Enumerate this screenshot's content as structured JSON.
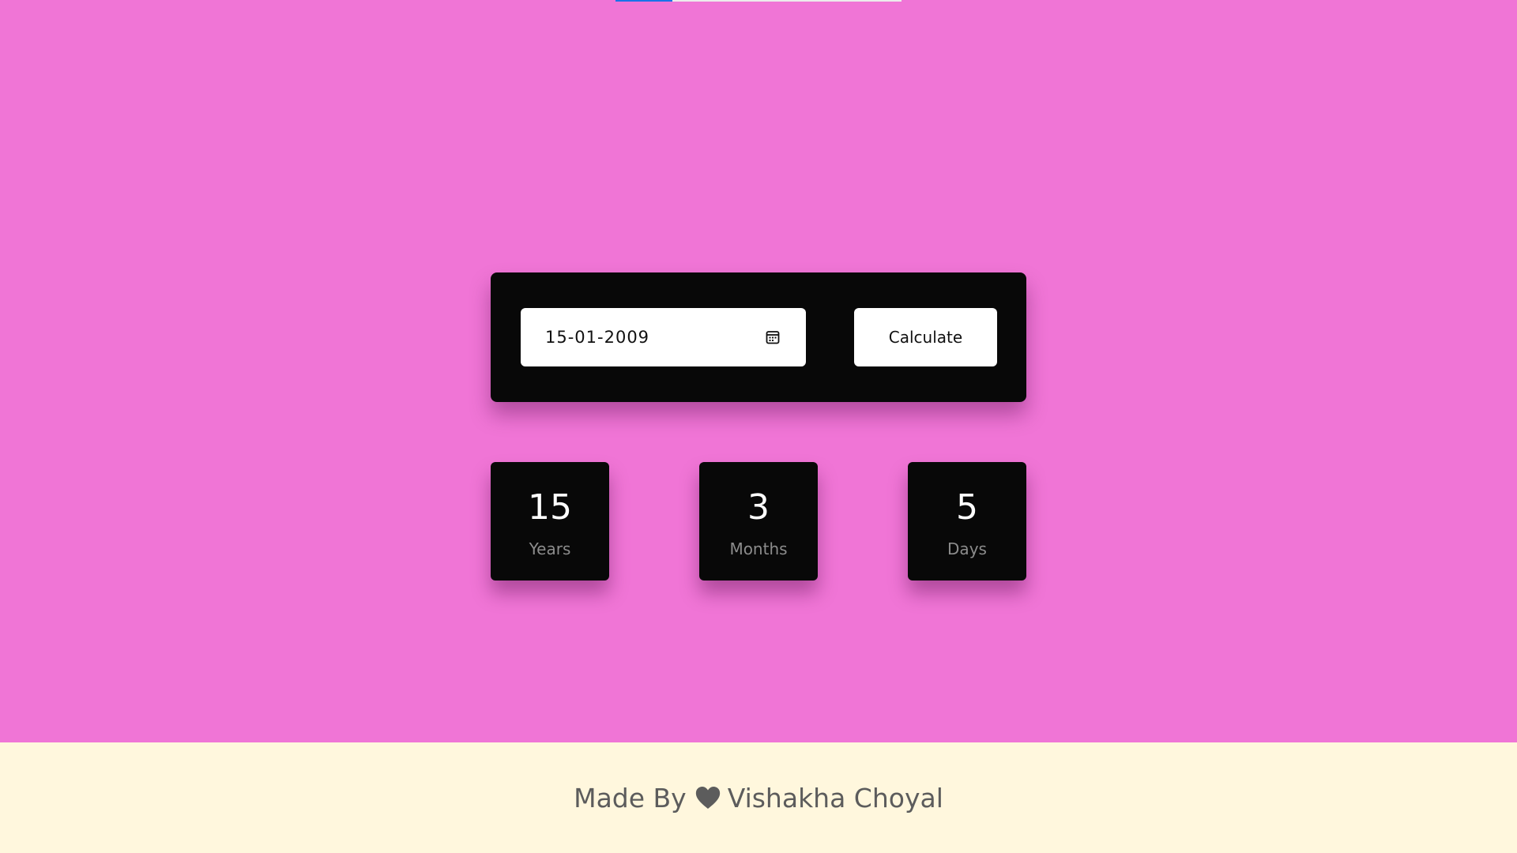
{
  "date_input": {
    "value": "15-01-2009",
    "icon": "calendar-icon"
  },
  "calculate_button": {
    "label": "Calculate"
  },
  "results": {
    "years": {
      "value": "15",
      "label": "Years"
    },
    "months": {
      "value": "3",
      "label": "Months"
    },
    "days": {
      "value": "5",
      "label": "Days"
    }
  },
  "footer": {
    "prefix": "Made By",
    "icon": "heart-icon",
    "author": "Vishakha Choyal"
  },
  "top_progress": {
    "percent": 20
  },
  "colors": {
    "background": "#f075d6",
    "panel": "#080808",
    "footer": "#fff7dd",
    "progress": "#1a73e8"
  }
}
